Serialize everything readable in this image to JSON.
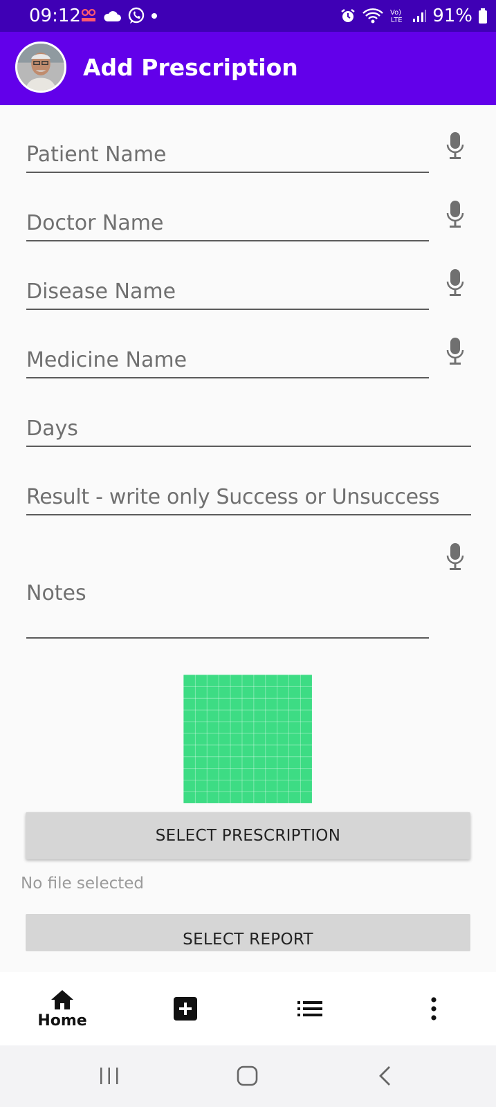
{
  "status_bar": {
    "time": "09:12",
    "battery": "91%"
  },
  "app_bar": {
    "title": "Add Prescription"
  },
  "form": {
    "patient_name_placeholder": "Patient Name",
    "doctor_name_placeholder": "Doctor Name",
    "disease_name_placeholder": "Disease Name",
    "medicine_name_placeholder": "Medicine Name",
    "days_placeholder": "Days",
    "result_placeholder": "Result - write only Success or Unsuccess",
    "notes_placeholder": "Notes"
  },
  "buttons": {
    "select_prescription": "SELECT PRESCRIPTION",
    "select_report": "SELECT REPORT"
  },
  "file_status": "No file selected",
  "bottom_nav": {
    "home_label": "Home"
  },
  "colors": {
    "status_bar": "#3f00b5",
    "app_bar": "#6200ea",
    "image_placeholder": "#3ddc84"
  }
}
